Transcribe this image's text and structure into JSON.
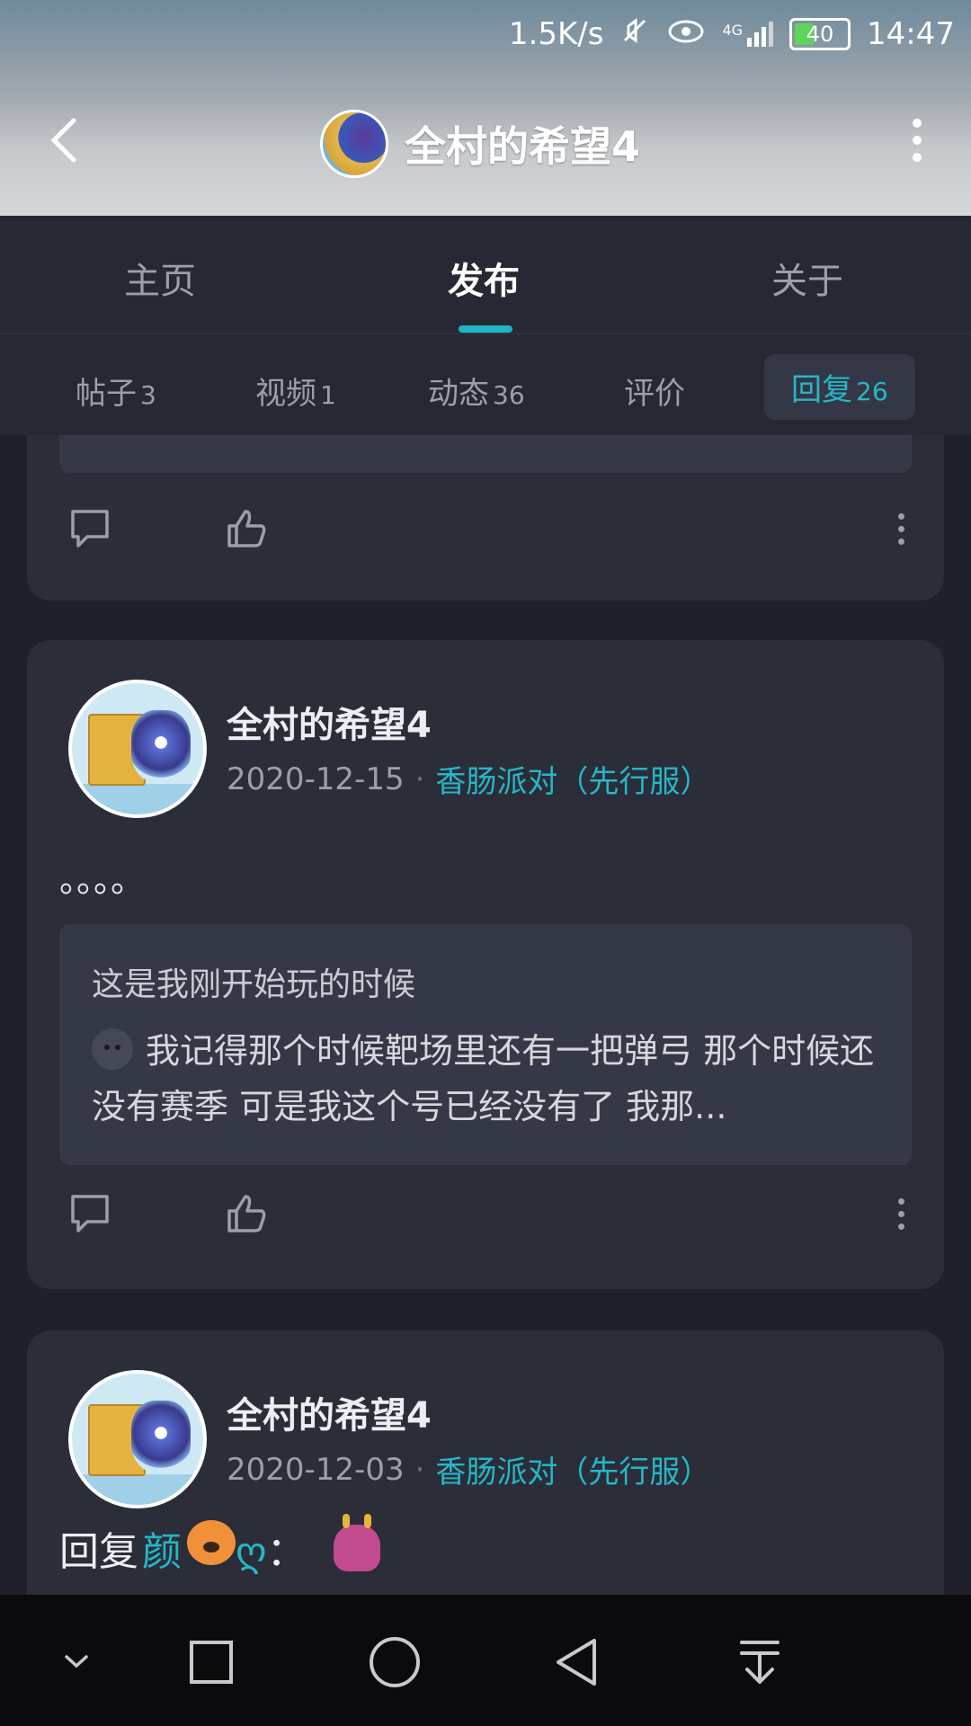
{
  "status_bar": {
    "net_speed": "1.5K/s",
    "signal": "4G",
    "battery": "40",
    "time": "14:47"
  },
  "header": {
    "title": "全村的希望4"
  },
  "tabs": [
    "主页",
    "发布",
    "关于"
  ],
  "active_tab": "发布",
  "subtabs": [
    {
      "label": "帖子",
      "count": "3"
    },
    {
      "label": "视频",
      "count": "1"
    },
    {
      "label": "动态",
      "count": "36"
    },
    {
      "label": "评价",
      "count": ""
    },
    {
      "label": "回复",
      "count": "26"
    }
  ],
  "active_subtab": "回复",
  "posts": [
    {
      "author": "全村的希望4",
      "date": "2020-12-15",
      "separator": "·",
      "game": "香肠派对（先行服）",
      "text": "。。。。",
      "quote_title": "这是我刚开始玩的时候",
      "quote_text": "我记得那个时候靶场里还有一把弹弓 那个时候还没有赛季 可是我这个号已经没有了 我那..."
    },
    {
      "author": "全村的希望4",
      "date": "2020-12-03",
      "separator": "·",
      "game": "香肠派对（先行服）",
      "reply_prefix": "回复",
      "reply_user": "颜",
      "reply_user_suffix": "ღ",
      "reply_colon": "："
    }
  ],
  "colors": {
    "accent": "#25b7c8",
    "background": "#1f2029",
    "card": "#2b2d39"
  },
  "icons": {
    "back": "chevron-left-icon",
    "more": "more-vertical-icon",
    "comment": "comment-icon",
    "like": "thumbs-up-icon",
    "nav": [
      "chevron-down-icon",
      "square-icon",
      "circle-icon",
      "triangle-back-icon",
      "download-icon"
    ]
  }
}
